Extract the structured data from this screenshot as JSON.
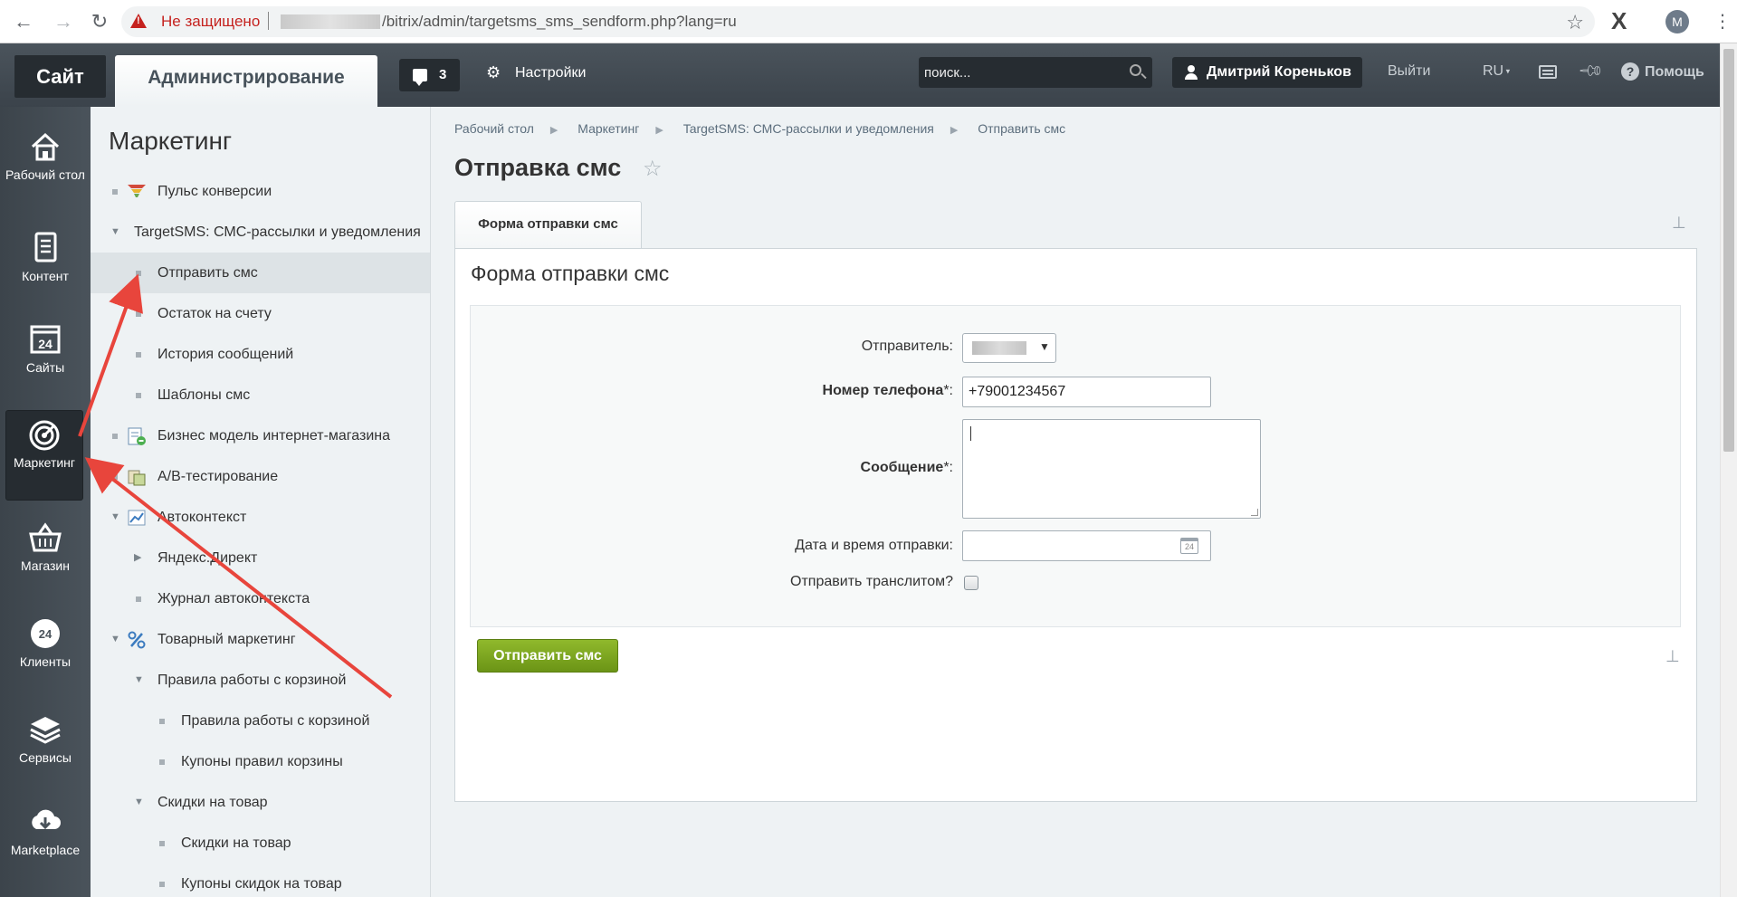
{
  "browser": {
    "not_secure": "Не защищено",
    "url": "/bitrix/admin/targetsms_sms_sendform.php?lang=ru",
    "profile_initial": "M"
  },
  "top_panel": {
    "site_tab": "Сайт",
    "admin_tab": "Администрирование",
    "notifications_count": "3",
    "settings": "Настройки",
    "search_placeholder": "поиск...",
    "user_name": "Дмитрий Кореньков",
    "logout": "Выйти",
    "lang": "RU",
    "help": "Помощь"
  },
  "left_menu": [
    {
      "label": "Рабочий стол",
      "icon": "home-icon"
    },
    {
      "label": "Контент",
      "icon": "document-icon"
    },
    {
      "label": "Сайты",
      "icon": "calendar-24-icon"
    },
    {
      "label": "Маркетинг",
      "icon": "target-icon"
    },
    {
      "label": "Магазин",
      "icon": "basket-icon"
    },
    {
      "label": "Клиенты",
      "icon": "clients-24-icon"
    },
    {
      "label": "Сервисы",
      "icon": "layers-icon"
    },
    {
      "label": "Marketplace",
      "icon": "cloud-download-icon"
    }
  ],
  "sidebar": {
    "title": "Маркетинг",
    "items": [
      {
        "label": "Пульс конверсии"
      },
      {
        "label": "TargetSMS: СМС-рассылки и уведомления"
      },
      {
        "label": "Отправить смс"
      },
      {
        "label": "Остаток на счету"
      },
      {
        "label": "История сообщений"
      },
      {
        "label": "Шаблоны смс"
      },
      {
        "label": "Бизнес модель интернет-магазина"
      },
      {
        "label": "A/B-тестирование"
      },
      {
        "label": "Автоконтекст"
      },
      {
        "label": "Яндекс.Директ"
      },
      {
        "label": "Журнал автоконтекста"
      },
      {
        "label": "Товарный маркетинг"
      },
      {
        "label": "Правила работы с корзиной"
      },
      {
        "label": "Правила работы с корзиной"
      },
      {
        "label": "Купоны правил корзины"
      },
      {
        "label": "Скидки на товар"
      },
      {
        "label": "Скидки на товар"
      },
      {
        "label": "Купоны скидок на товар"
      }
    ]
  },
  "main": {
    "breadcrumb": [
      "Рабочий стол",
      "Маркетинг",
      "TargetSMS: СМС-рассылки и уведомления",
      "Отправить смс"
    ],
    "page_title": "Отправка смс",
    "tab_label": "Форма отправки смс",
    "form_heading": "Форма отправки смс",
    "fields": {
      "sender_label": "Отправитель:",
      "phone_label": "Номер телефона",
      "phone_value": "+79001234567",
      "message_label": "Сообщение",
      "required_mark": "*:",
      "datetime_label": "Дата и время отправки:",
      "translit_label": "Отправить транслитом?"
    },
    "submit_label": "Отправить смс"
  },
  "colors": {
    "accent_green": "#7aa51f",
    "annotation_arrow": "#e8453c",
    "panel_dark": "#3b434b"
  }
}
